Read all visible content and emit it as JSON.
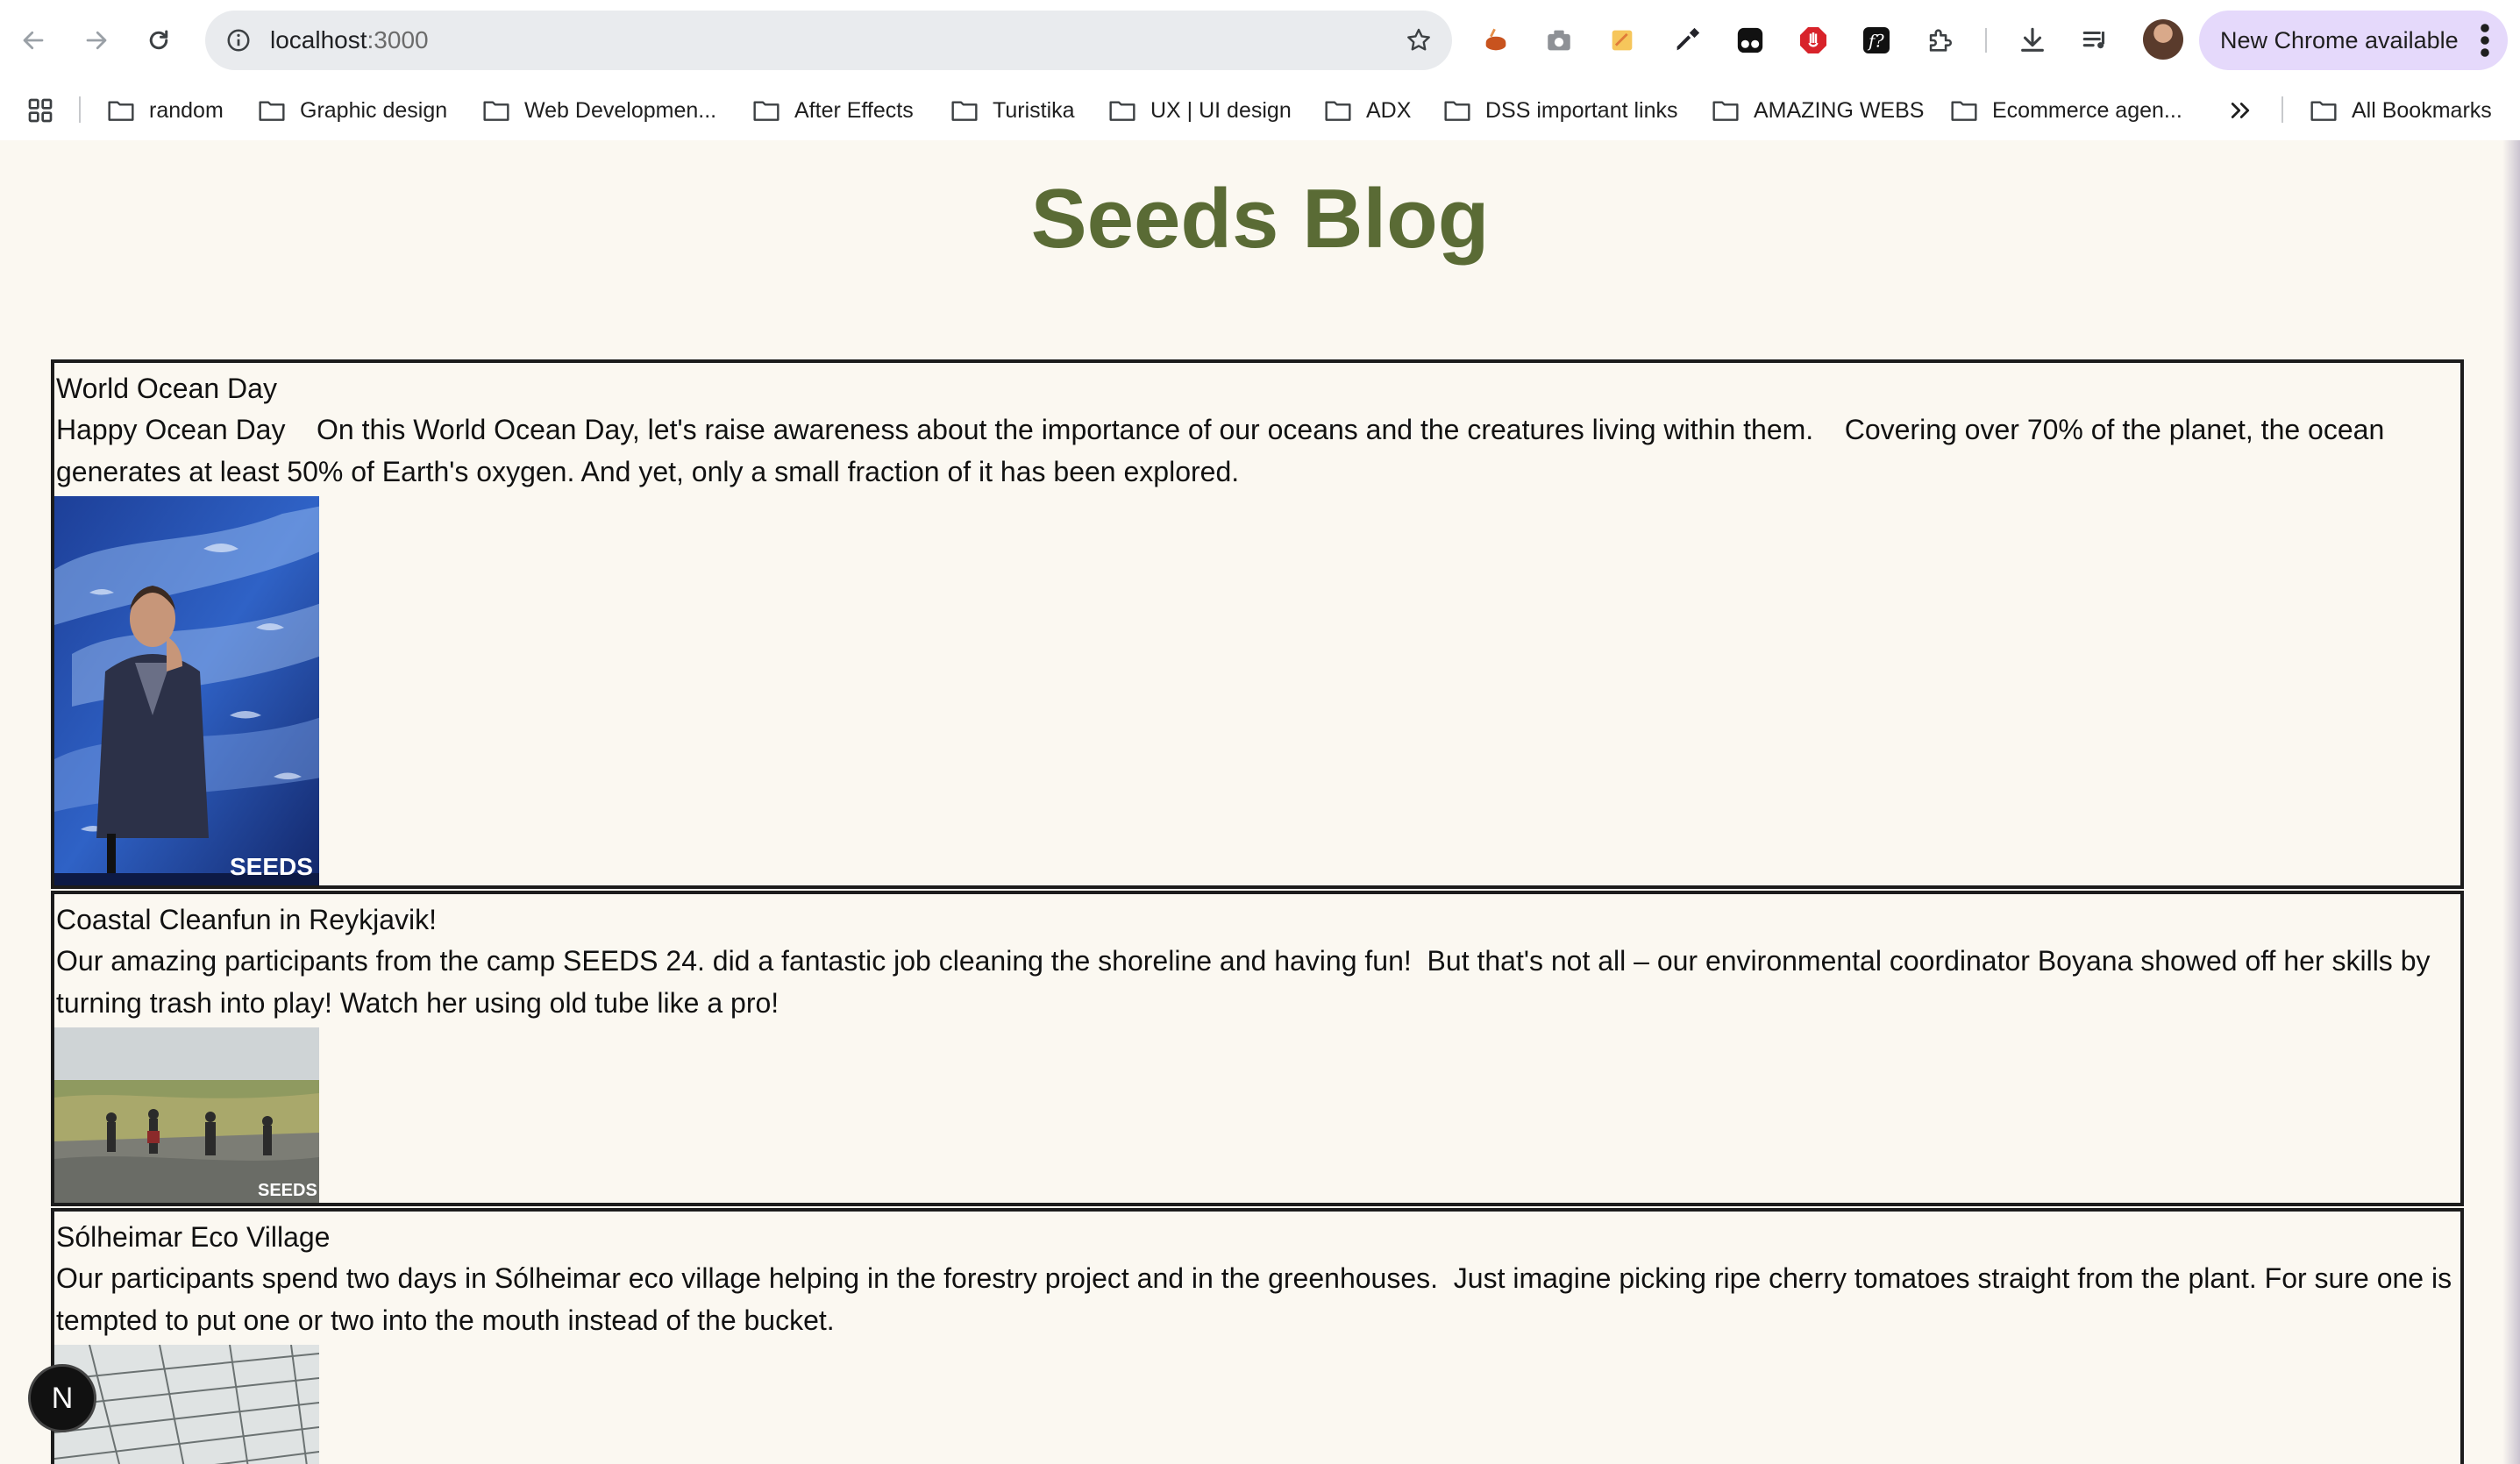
{
  "browser": {
    "url_host": "localhost",
    "url_port": ":3000",
    "update_label": "New Chrome available",
    "bookmarks": [
      {
        "label": "random"
      },
      {
        "label": "Graphic design"
      },
      {
        "label": "Web Developmen..."
      },
      {
        "label": "After Effects"
      },
      {
        "label": "Turistika"
      },
      {
        "label": "UX | UI design"
      },
      {
        "label": "ADX"
      },
      {
        "label": "DSS important links"
      },
      {
        "label": "AMAZING WEBS"
      },
      {
        "label": "Ecommerce agen..."
      }
    ],
    "all_bookmarks_label": "All Bookmarks"
  },
  "page": {
    "title": "Seeds Blog",
    "title_color": "#5a6b35",
    "posts": [
      {
        "title": "World Ocean Day",
        "body": "Happy Ocean Day    On this World Ocean Day, let's raise awareness about the importance of our oceans and the creatures living within them.    Covering over 70% of the planet, the ocean generates at least 50% of Earth's oxygen. And yet, only a small fraction of it has been explored.",
        "image_watermark": "SEEDS"
      },
      {
        "title": "Coastal Cleanfun in Reykjavik!",
        "body": "Our amazing participants from the camp SEEDS 24. did a fantastic job cleaning the shoreline and having fun!  But that's not all – our environmental coordinator Boyana showed off her skills by turning trash into play! Watch her using old tube like a pro!",
        "image_watermark": "SEEDS"
      },
      {
        "title": "Sólheimar Eco Village",
        "body": "Our participants spend two days in Sólheimar eco village helping in the forestry project and in the greenhouses.  Just imagine picking ripe cherry tomatoes straight from the plant. For sure one is tempted to put one or two into the mouth instead of the bucket."
      }
    ]
  },
  "dev_badge": "N"
}
